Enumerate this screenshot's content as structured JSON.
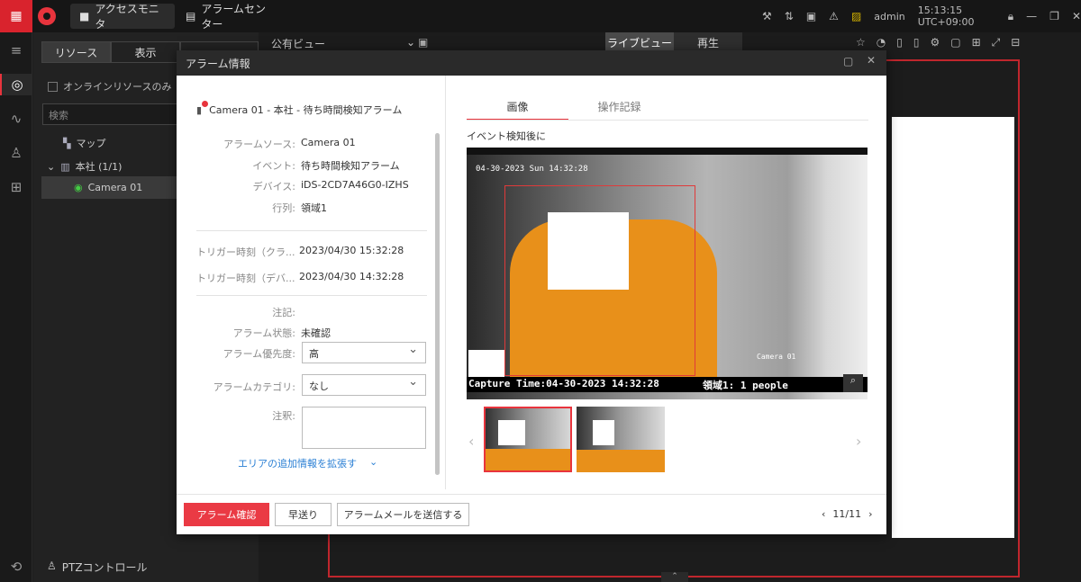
{
  "topbar": {
    "tabs": [
      {
        "label": "アクセスモニタ",
        "icon": "camera-icon"
      },
      {
        "label": "アラームセンター",
        "icon": "alarm-book-icon"
      }
    ],
    "user": "admin",
    "clock": "15:13:15 UTC+09:00"
  },
  "left_panel": {
    "tabs": [
      "リソース",
      "表示"
    ],
    "online_only": "オンラインリソースのみ",
    "search_placeholder": "検索",
    "tree": [
      {
        "label": "マップ"
      },
      {
        "label": "本社 (1/1)"
      },
      {
        "label": "Camera 01"
      }
    ],
    "ptz": "PTZコントロール"
  },
  "view_toolbar": {
    "public_view": "公有ビュー",
    "live_tab": "ライブビュー",
    "playback_tab": "再生"
  },
  "dialog": {
    "title": "アラーム情報",
    "alarm_title": "Camera 01 - 本社 - 待ち時間検知アラーム",
    "fields": {
      "source_label": "アラームソース:",
      "source_value": "Camera 01",
      "event_label": "イベント:",
      "event_value": "待ち時間検知アラーム",
      "device_label": "デバイス:",
      "device_value": "iDS-2CD7A46G0-IZHS",
      "row_label": "行列:",
      "row_value": "領域1",
      "trigger_client_label": "トリガー時刻（クラ...",
      "trigger_client_value": "2023/04/30 15:32:28",
      "trigger_device_label": "トリガー時刻（デバ...",
      "trigger_device_value": "2023/04/30 14:32:28",
      "note_label": "注記:",
      "status_label": "アラーム状態:",
      "status_value": "未確認",
      "priority_label": "アラーム優先度:",
      "priority_value": "高",
      "category_label": "アラームカテゴリ:",
      "category_value": "なし",
      "comment_label": "注釈:"
    },
    "expand_link": "エリアの追加情報を拡張す",
    "tabs": [
      "画像",
      "操作記録"
    ],
    "image_caption": "イベント検知後に",
    "osd_top": "04-30-2023 Sun 14:32:28",
    "osd_camera": "Camera 01",
    "osd_bottom_left": "Capture Time:04-30-2023 14:32:28",
    "osd_bottom_right": "領域1: 1 people",
    "buttons": {
      "confirm": "アラーム確認",
      "forward": "早送り",
      "send_mail": "アラームメールを送信する"
    },
    "pager": "11/11"
  }
}
